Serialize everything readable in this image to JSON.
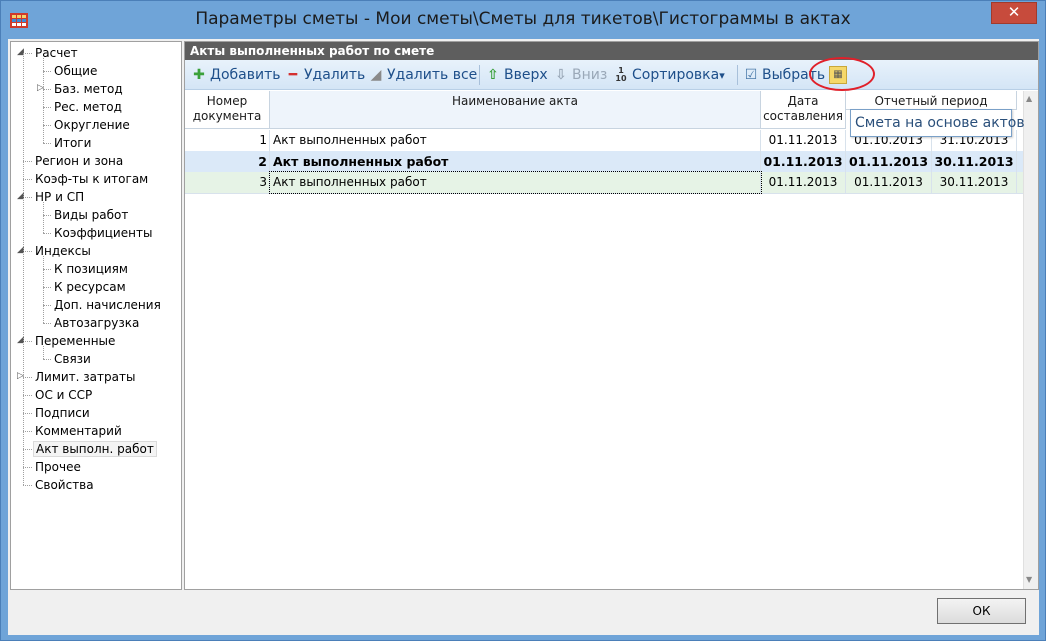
{
  "window": {
    "title": "Параметры сметы - Мои сметы\\Сметы для тикетов\\Гистограммы в актах",
    "close_label": "✕"
  },
  "tree": {
    "items": [
      {
        "label": "Расчет",
        "level": 0,
        "expander": "◢"
      },
      {
        "label": "Общие",
        "level": 1
      },
      {
        "label": "Баз. метод",
        "level": 1,
        "expander": "▷"
      },
      {
        "label": "Рес. метод",
        "level": 1
      },
      {
        "label": "Округление",
        "level": 1
      },
      {
        "label": "Итоги",
        "level": 1
      },
      {
        "label": "Регион и зона",
        "level": 0
      },
      {
        "label": "Коэф-ты к итогам",
        "level": 0
      },
      {
        "label": "НР и СП",
        "level": 0,
        "expander": "◢"
      },
      {
        "label": "Виды работ",
        "level": 1
      },
      {
        "label": "Коэффициенты",
        "level": 1
      },
      {
        "label": "Индексы",
        "level": 0,
        "expander": "◢"
      },
      {
        "label": "К позициям",
        "level": 1
      },
      {
        "label": "К ресурсам",
        "level": 1
      },
      {
        "label": "Доп. начисления",
        "level": 1
      },
      {
        "label": "Автозагрузка",
        "level": 1
      },
      {
        "label": "Переменные",
        "level": 0,
        "expander": "◢"
      },
      {
        "label": "Связи",
        "level": 1
      },
      {
        "label": "Лимит. затраты",
        "level": 0,
        "expander": "▷"
      },
      {
        "label": "ОС и ССР",
        "level": 0
      },
      {
        "label": "Подписи",
        "level": 0
      },
      {
        "label": "Комментарий",
        "level": 0
      },
      {
        "label": "Акт выполн. работ",
        "level": 0,
        "selected": true
      },
      {
        "label": "Прочее",
        "level": 0
      },
      {
        "label": "Свойства",
        "level": 0
      }
    ]
  },
  "panel": {
    "header": "Акты выполненных работ по смете"
  },
  "toolbar": {
    "add": "Добавить",
    "delete": "Удалить",
    "delete_all": "Удалить все",
    "up": "Вверх",
    "down": "Вниз",
    "sort": "Сортировка",
    "sort_icon_top": "1",
    "sort_icon_bottom": "10",
    "select": "Выбрать",
    "dropdown_arrow": "▾"
  },
  "grid": {
    "headers": {
      "number": "Номер документа",
      "name": "Наименование акта",
      "date": "Дата составления",
      "period": "Отчетный период"
    },
    "rows": [
      {
        "num": "1",
        "name": "Акт выполненных работ",
        "date": "01.11.2013",
        "from": "01.10.2013",
        "to": "31.10.2013"
      },
      {
        "num": "2",
        "name": "Акт выполненных работ",
        "date": "01.11.2013",
        "from": "01.11.2013",
        "to": "30.11.2013"
      },
      {
        "num": "3",
        "name": "Акт выполненных работ",
        "date": "01.11.2013",
        "from": "01.11.2013",
        "to": "30.11.2013"
      }
    ]
  },
  "tooltip": "Смета на основе актов",
  "ok_button": "ОК",
  "colors": {
    "accent": "#1e4f8a",
    "highlight": "#e0202a",
    "row_selected": "#dbe9f8",
    "row_current": "#e6f3e6"
  }
}
